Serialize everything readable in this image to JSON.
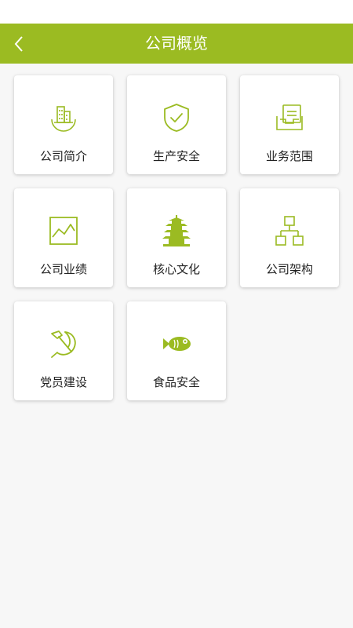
{
  "header": {
    "title": "公司概览",
    "bar_color": "#9bbb22",
    "back_icon": "chevron-left-icon"
  },
  "accent_color": "#9bbb22",
  "menu": {
    "items": [
      {
        "label": "公司简介",
        "icon": "building-icon"
      },
      {
        "label": "生产安全",
        "icon": "shield-check-icon"
      },
      {
        "label": "业务范围",
        "icon": "document-tray-icon"
      },
      {
        "label": "公司业绩",
        "icon": "line-chart-icon"
      },
      {
        "label": "核心文化",
        "icon": "pagoda-icon"
      },
      {
        "label": "公司架构",
        "icon": "org-chart-icon"
      },
      {
        "label": "党员建设",
        "icon": "hammer-sickle-icon"
      },
      {
        "label": "食品安全",
        "icon": "fish-icon"
      }
    ]
  }
}
